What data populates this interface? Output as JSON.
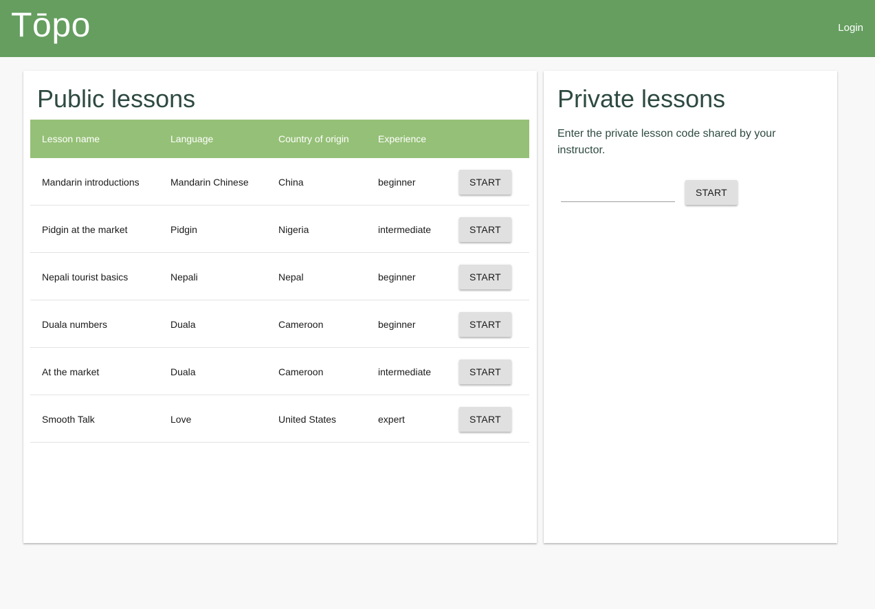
{
  "app": {
    "logo": "Tōpo",
    "login_label": "Login"
  },
  "public_lessons": {
    "title": "Public lessons",
    "columns": [
      "Lesson name",
      "Language",
      "Country of origin",
      "Experience"
    ],
    "rows": [
      {
        "name": "Mandarin introductions",
        "language": "Mandarin Chinese",
        "country": "China",
        "experience": "beginner",
        "action": "START"
      },
      {
        "name": "Pidgin at the market",
        "language": "Pidgin",
        "country": "Nigeria",
        "experience": "intermediate",
        "action": "START"
      },
      {
        "name": "Nepali tourist basics",
        "language": "Nepali",
        "country": "Nepal",
        "experience": "beginner",
        "action": "START"
      },
      {
        "name": "Duala numbers",
        "language": "Duala",
        "country": "Cameroon",
        "experience": "beginner",
        "action": "START"
      },
      {
        "name": "At the market",
        "language": "Duala",
        "country": "Cameroon",
        "experience": "intermediate",
        "action": "START"
      },
      {
        "name": "Smooth Talk",
        "language": "Love",
        "country": "United States",
        "experience": "expert",
        "action": "START"
      }
    ]
  },
  "private_lessons": {
    "title": "Private lessons",
    "description": "Enter the private lesson code shared by your instructor.",
    "code_value": "",
    "start_label": "START"
  },
  "colors": {
    "topbar": "#659e5f",
    "table_header": "#95c077",
    "heading_text": "#2e4a42",
    "button_bg": "#e0e0e0"
  }
}
